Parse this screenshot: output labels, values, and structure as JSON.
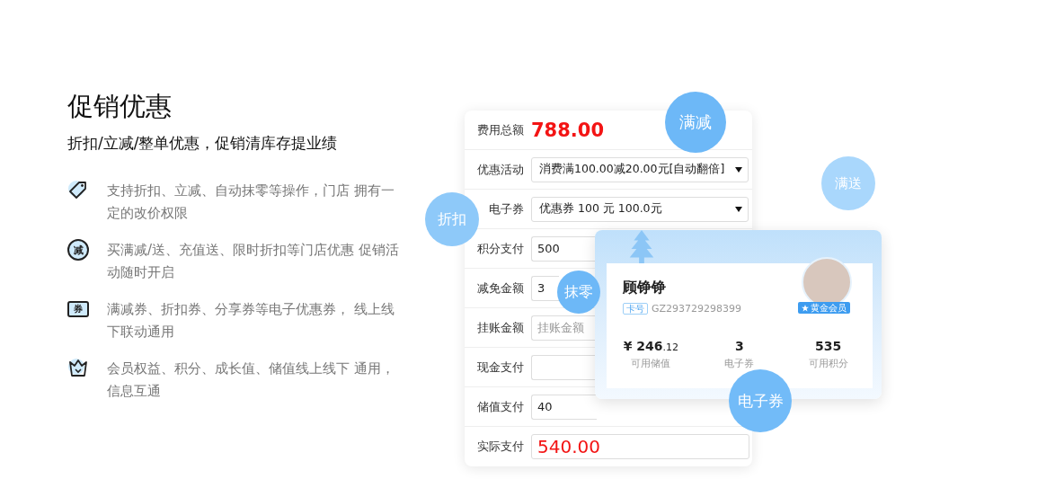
{
  "title": "促销优惠",
  "subtitle": "折扣/立减/整单优惠，促销清库存提业绩",
  "features": [
    {
      "kind": "tag",
      "text": "支持折扣、立减、自动抹零等操作，门店 拥有一定的改价权限"
    },
    {
      "kind": "badge",
      "glyph": "减",
      "text": "买满减/送、充值送、限时折扣等门店优惠 促销活动随时开启"
    },
    {
      "kind": "ticket",
      "glyph": "券",
      "text": "满减券、折扣券、分享券等电子优惠券， 线上线下联动通用"
    },
    {
      "kind": "crown",
      "text": "会员权益、积分、成长值、储值线上线下 通用，信息互通"
    }
  ],
  "form": {
    "rows": [
      {
        "kind": "total",
        "label": "费用总额",
        "value": "788.00"
      },
      {
        "kind": "select",
        "label": "优惠活动",
        "value": "消费满100.00减20.00元[自动翻倍]"
      },
      {
        "kind": "select",
        "label": "电子券",
        "value": "优惠券 100 元 100.0元"
      },
      {
        "kind": "input",
        "label": "积分支付",
        "value": "500"
      },
      {
        "kind": "input",
        "label": "减免金额",
        "value": "3"
      },
      {
        "kind": "input",
        "label": "挂账金额",
        "placeholder": "挂账金额"
      },
      {
        "kind": "input",
        "label": "现金支付"
      },
      {
        "kind": "input",
        "label": "储值支付",
        "value": "40"
      },
      {
        "kind": "payable",
        "label": "实际支付",
        "value": "540.00"
      }
    ]
  },
  "member": {
    "name": "顾铮铮",
    "card_label": "卡号",
    "card_no": "GZ293729298399",
    "level_badge": "黄金会员",
    "stats": [
      {
        "value": "¥ 246",
        "fraction": ".12",
        "label": "可用储值"
      },
      {
        "value": "3",
        "label": "电子券"
      },
      {
        "value": "535",
        "label": "可用积分"
      }
    ]
  },
  "bubbles": [
    {
      "text": "满减",
      "color": "#6db8f7"
    },
    {
      "text": "折扣",
      "color": "#8ec9f9"
    },
    {
      "text": "满送",
      "color": "#a9d7fc"
    },
    {
      "text": "抹零",
      "color": "#6db8f7"
    },
    {
      "text": "电子券",
      "color": "#72bbf8"
    }
  ]
}
